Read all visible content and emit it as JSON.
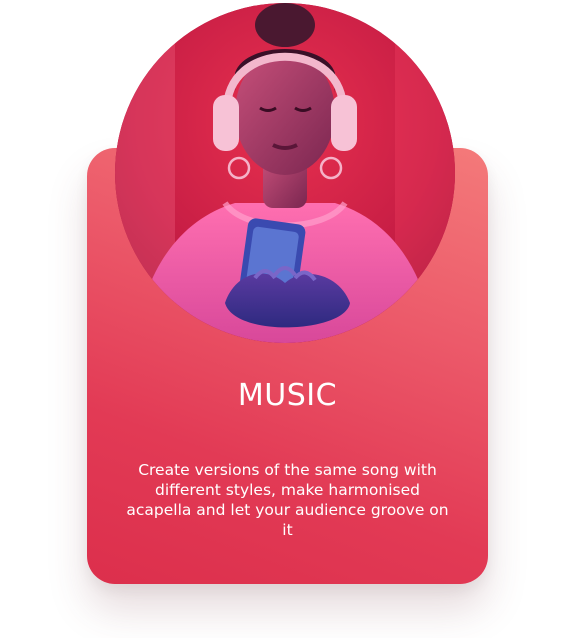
{
  "card": {
    "title": "MUSIC",
    "description": "Create versions of the same song with different styles, make harmonised acapella and let your audience groove on it",
    "image": "woman-with-headphones-photo"
  },
  "colors": {
    "card_top": "#f47a7a",
    "card_bottom": "#dc2f4c",
    "text": "#ffffff"
  }
}
